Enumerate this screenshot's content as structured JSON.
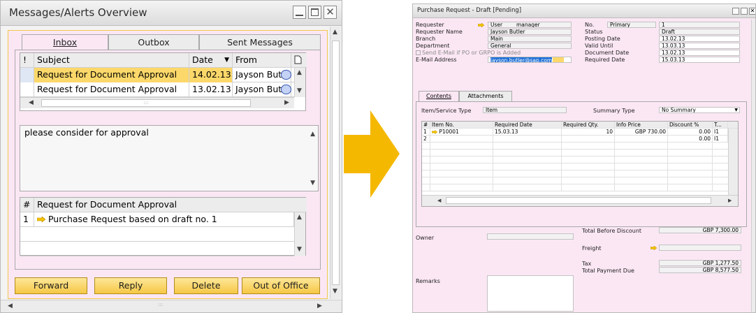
{
  "left": {
    "title": "Messages/Alerts Overview",
    "window_close": "✕",
    "tabs": [
      "Inbox",
      "Outbox",
      "Sent Messages"
    ],
    "grid_headers": [
      "!",
      "Subject",
      "Date",
      "From"
    ],
    "rows": [
      {
        "subject": "Request for Document Approval",
        "date": "14.02.13",
        "from": "Jayson Butler"
      },
      {
        "subject": "Request for Document Approval",
        "date": "13.02.13",
        "from": "Jayson Butler"
      }
    ],
    "message_text": "please consider for approval",
    "detail_headers": [
      "#",
      "Request for Document Approval"
    ],
    "detail_rows": [
      {
        "num": "1",
        "text": "Purchase Request based on draft no. 1"
      }
    ],
    "buttons": [
      "Forward",
      "Reply",
      "Delete",
      "Out of Office"
    ],
    "scroll_grip": ":::"
  },
  "right": {
    "title": "Purchase Request - Draft [Pending]",
    "window_close": "✕",
    "left_labels": [
      "Requester",
      "Requester Name",
      "Branch",
      "Department",
      "Send E-Mail if PO or GRPO is Added",
      "E-Mail Address"
    ],
    "requester_type": "User",
    "requester_code": "manager",
    "requester_name": "Jayson Butler",
    "branch": "Main",
    "department": "General",
    "email": "jayson.butler@sap.com",
    "right_labels": [
      "No.",
      "Status",
      "Posting Date",
      "Valid Until",
      "Document Date",
      "Required Date"
    ],
    "series": "Primary",
    "doc_no": "1",
    "status": "Draft",
    "posting_date": "13.02.13",
    "valid_until": "13.03.13",
    "document_date": "13.02.13",
    "required_date": "15.03.13",
    "tabs": [
      "Contents",
      "Attachments"
    ],
    "item_service_type_label": "Item/Service Type",
    "item_service_type": "Item",
    "summary_type_label": "Summary Type",
    "summary_type": "No Summary",
    "grid_headers": [
      "#",
      "Item No.",
      "Required Date",
      "Required Qty.",
      "Info Price",
      "Discount %",
      "T..."
    ],
    "rows": [
      {
        "num": "1",
        "item": "P10001",
        "req_date": "15.03.13",
        "qty": "10",
        "price": "GBP 730.00",
        "discount": "0.00",
        "tax": "I1"
      },
      {
        "num": "2",
        "item": "",
        "req_date": "",
        "qty": "",
        "price": "",
        "discount": "0.00",
        "tax": "I1"
      }
    ],
    "owner_label": "Owner",
    "remarks_label": "Remarks",
    "totals_labels": [
      "Total Before Discount",
      "Freight",
      "Tax",
      "Total Payment Due"
    ],
    "total_before_discount": "GBP 7,300.00",
    "tax": "GBP 1,277.50",
    "total_payment_due": "GBP 8,577.50"
  },
  "colors": {
    "arrow": "#f5b800",
    "selected_row": "#fcd86a",
    "form_bg": "#fbe7f4",
    "button": "#f6c744"
  }
}
